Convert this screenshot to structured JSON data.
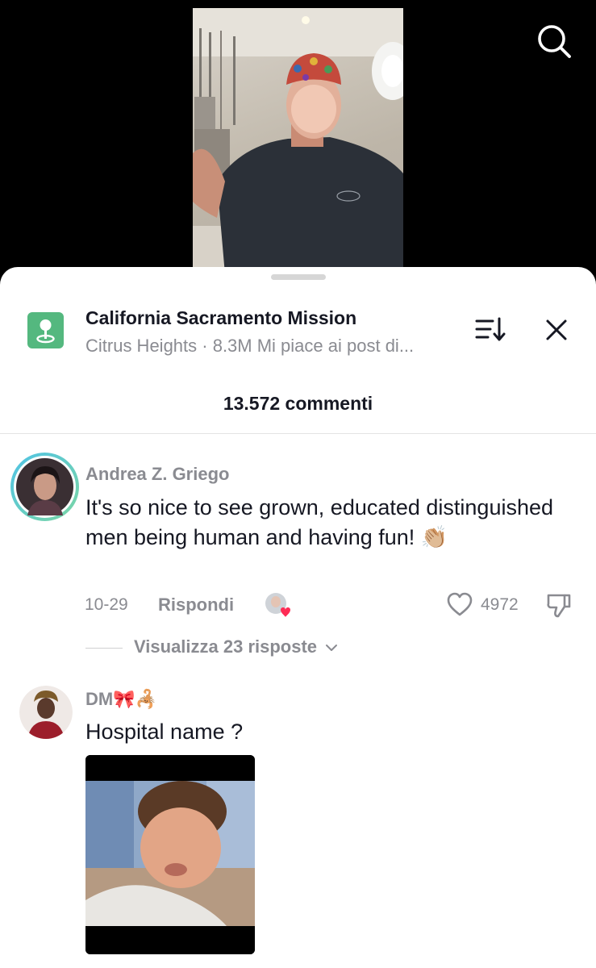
{
  "header": {
    "search_icon": "search-icon"
  },
  "sheet": {
    "location_icon": "location-pin-icon",
    "location_title": "California Sacramento Mission",
    "location_subtitle": "Citrus Heights · 8.3M Mi piace ai post di...",
    "sort_icon": "sort-icon",
    "close_icon": "close-icon",
    "comment_count": "13.572 commenti"
  },
  "comments": [
    {
      "username": "Andrea Z. Griego",
      "text": "It's so nice to see grown, educated distinguished men being human and having fun! 👏🏼",
      "date": "10-29",
      "reply_label": "Rispondi",
      "likes": "4972",
      "view_replies": "Visualizza 23 risposte"
    },
    {
      "username": "DM🎀🦂",
      "text": "Hospital name ?"
    }
  ],
  "colors": {
    "accent_green": "#54b87f",
    "text_primary": "#161823",
    "text_secondary": "#8a8b91",
    "like_heart": "#fe2c55"
  }
}
